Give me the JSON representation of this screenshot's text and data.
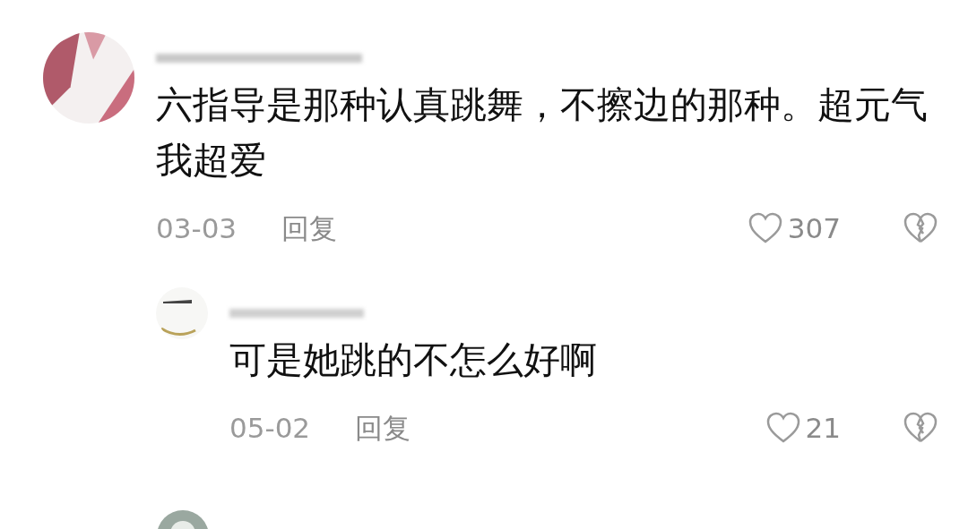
{
  "comments": [
    {
      "text": "六指导是那种认真跳舞，不擦边的那种。超元气我超爱",
      "date": "03-03",
      "reply_label": "回复",
      "likes": "307",
      "replies": [
        {
          "text": "可是她跳的不怎么好啊",
          "date": "05-02",
          "reply_label": "回复",
          "likes": "21"
        }
      ]
    }
  ]
}
